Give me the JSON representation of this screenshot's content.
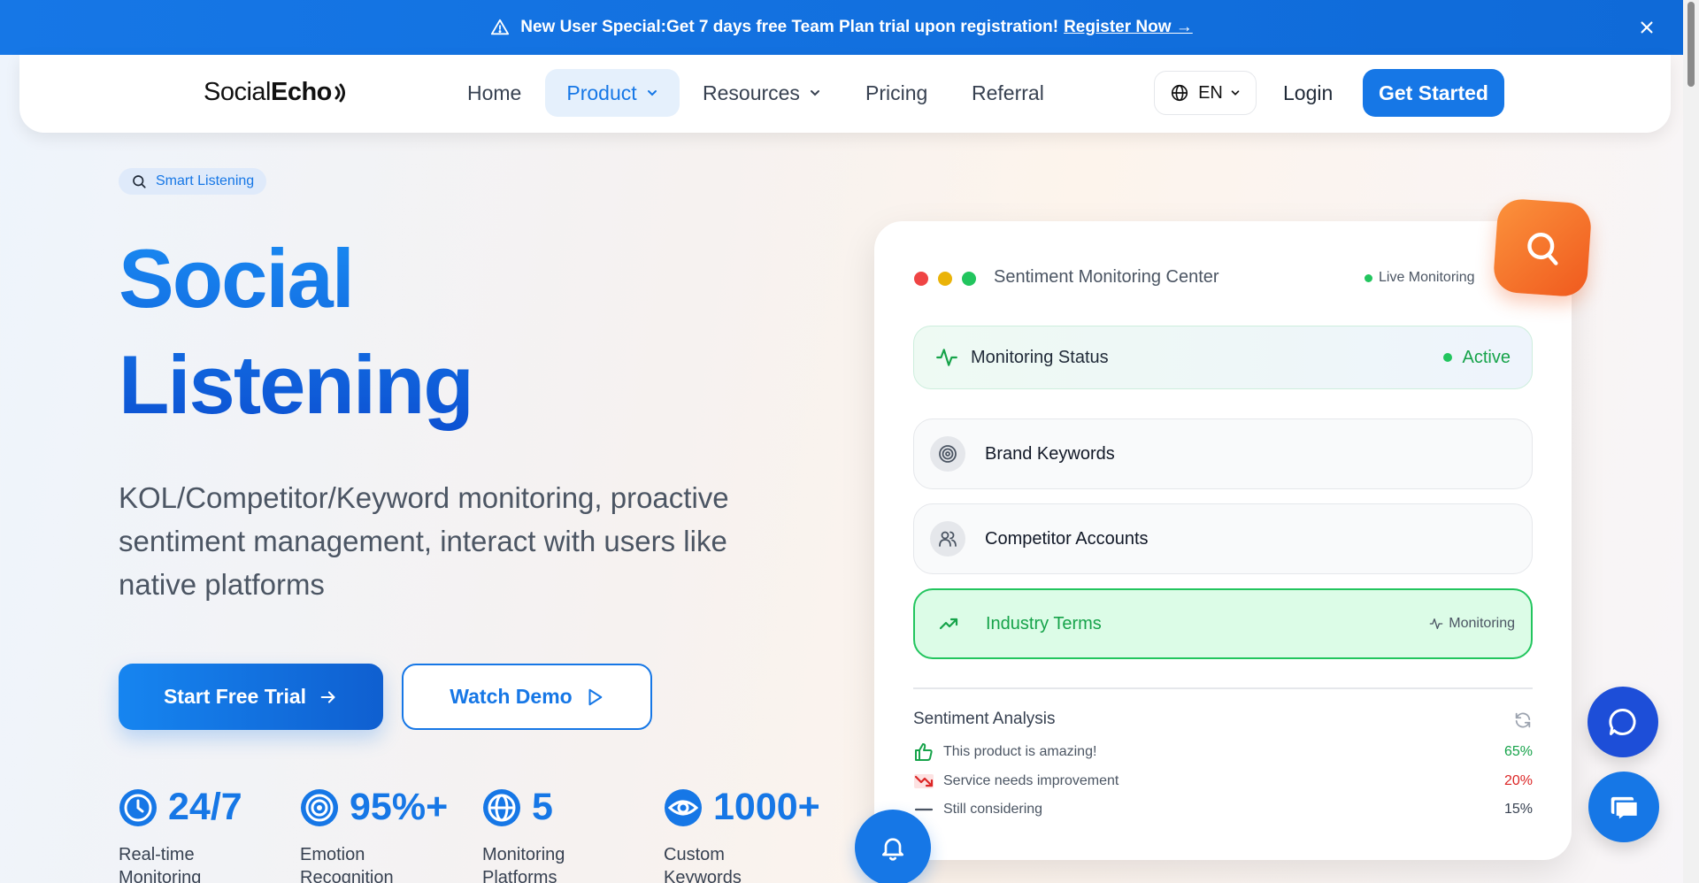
{
  "announcement": {
    "bold_text": "New User Special:",
    "text": "Get 7 days free Team Plan trial upon registration!",
    "link": "Register Now →"
  },
  "nav": {
    "logo_social": "Social",
    "logo_echo": "Echo",
    "items": [
      {
        "label": "Home"
      },
      {
        "label": "Product"
      },
      {
        "label": "Resources"
      },
      {
        "label": "Pricing"
      },
      {
        "label": "Referral"
      }
    ],
    "language": "EN",
    "login": "Login",
    "get_started": "Get Started"
  },
  "hero": {
    "tag": "Smart Listening",
    "title_line1": "Social",
    "title_line2": "Listening",
    "description": "KOL/Competitor/Keyword monitoring, proactive sentiment management, interact with users like native platforms",
    "primary_cta": "Start Free Trial",
    "secondary_cta": "Watch Demo",
    "stats": [
      {
        "value": "24/7",
        "label": "Real-time Monitoring",
        "icon": "clock-icon"
      },
      {
        "value": "95%+",
        "label": "Emotion Recognition",
        "icon": "target-icon"
      },
      {
        "value": "5",
        "label": "Monitoring Platforms",
        "icon": "globe-icon"
      },
      {
        "value": "1000+",
        "label": "Custom Keywords",
        "icon": "eye-icon"
      }
    ]
  },
  "card": {
    "title": "Sentiment Monitoring Center",
    "live": "Live Monitoring",
    "status_label": "Monitoring Status",
    "status_value": "Active",
    "keywords": [
      {
        "label": "Brand Keywords",
        "icon": "target-icon"
      },
      {
        "label": "Competitor Accounts",
        "icon": "users-icon"
      },
      {
        "label": "Industry Terms",
        "icon": "trending-up-icon",
        "badge": "Monitoring"
      }
    ],
    "sentiment_title": "Sentiment Analysis",
    "sentiments": [
      {
        "text": "This product is amazing!",
        "pct": "65%",
        "color": "#16a34a"
      },
      {
        "text": "Service needs improvement",
        "pct": "20%",
        "color": "#dc2626"
      },
      {
        "text": "Still considering",
        "pct": "15%",
        "color": "#374151"
      }
    ]
  },
  "colors": {
    "brand": "#1677e6",
    "accent_orange": "#f05a1e",
    "success": "#16a34a"
  }
}
